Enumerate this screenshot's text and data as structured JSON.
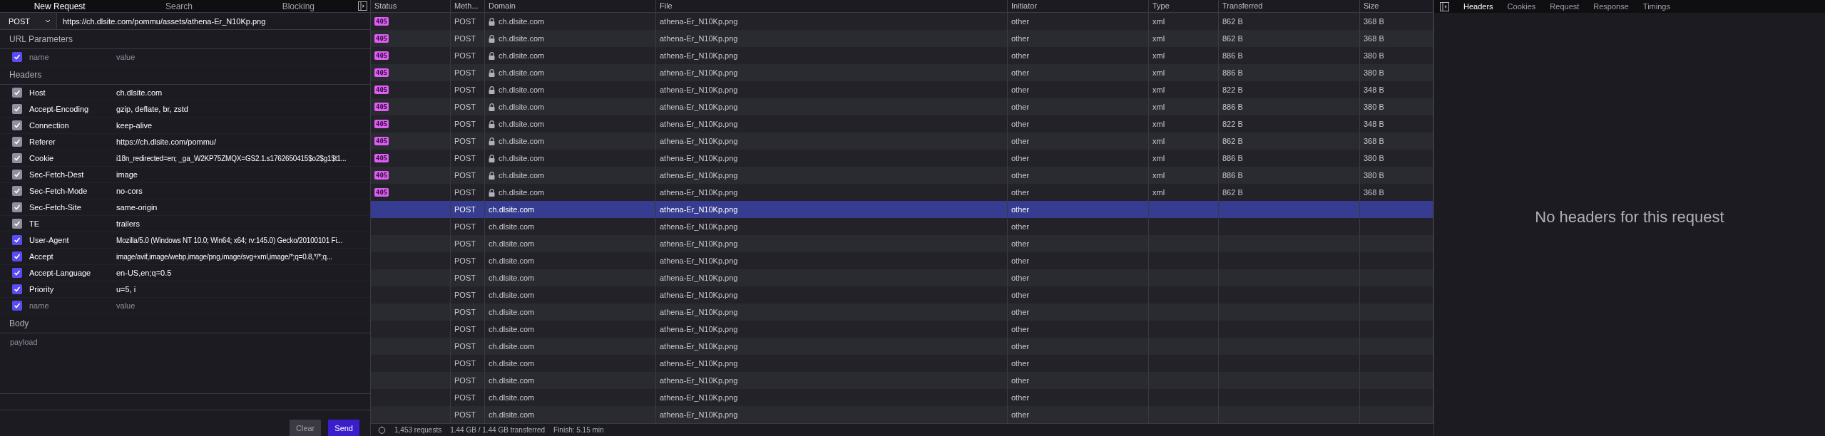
{
  "request_panel": {
    "tabs": [
      {
        "label": "New Request",
        "selected": true
      },
      {
        "label": "Search",
        "selected": false
      },
      {
        "label": "Blocking",
        "selected": false
      }
    ],
    "method": "POST",
    "url": "https://ch.dlsite.com/pommu/assets/athena-Er_N10Kp.png",
    "url_parameters": {
      "title": "URL Parameters",
      "rows": [
        {
          "name_placeholder": "name",
          "value_placeholder": "value",
          "checked": true,
          "disabled": false
        }
      ]
    },
    "headers": {
      "title": "Headers",
      "rows": [
        {
          "name": "Host",
          "value": "ch.dlsite.com",
          "checked": true,
          "disabled": true
        },
        {
          "name": "Accept-Encoding",
          "value": "gzip, deflate, br, zstd",
          "checked": true,
          "disabled": true
        },
        {
          "name": "Connection",
          "value": "keep-alive",
          "checked": true,
          "disabled": true
        },
        {
          "name": "Referer",
          "value": "https://ch.dlsite.com/pommu/",
          "checked": true,
          "disabled": true
        },
        {
          "name": "Cookie",
          "value": "i18n_redirected=en; _ga_W2KP75ZMQX=GS2.1.s1762650415$o2$g1$t1...",
          "checked": true,
          "disabled": true
        },
        {
          "name": "Sec-Fetch-Dest",
          "value": "image",
          "checked": true,
          "disabled": true
        },
        {
          "name": "Sec-Fetch-Mode",
          "value": "no-cors",
          "checked": true,
          "disabled": true
        },
        {
          "name": "Sec-Fetch-Site",
          "value": "same-origin",
          "checked": true,
          "disabled": true
        },
        {
          "name": "TE",
          "value": "trailers",
          "checked": true,
          "disabled": true
        },
        {
          "name": "User-Agent",
          "value": "Mozilla/5.0 (Windows NT 10.0; Win64; x64; rv:145.0) Gecko/20100101 Fi...",
          "checked": true,
          "disabled": false
        },
        {
          "name": "Accept",
          "value": "image/avif,image/webp,image/png,image/svg+xml,image/*;q=0.8,*/*;q...",
          "checked": true,
          "disabled": false
        },
        {
          "name": "Accept-Language",
          "value": "en-US,en;q=0.5",
          "checked": true,
          "disabled": false
        },
        {
          "name": "Priority",
          "value": "u=5, i",
          "checked": true,
          "disabled": false
        },
        {
          "name_placeholder": "name",
          "value_placeholder": "value",
          "checked": true,
          "disabled": false
        }
      ]
    },
    "body": {
      "title": "Body",
      "placeholder": "payload"
    },
    "buttons": [
      {
        "label": "Clear",
        "kind": "secondary"
      },
      {
        "label": "Send",
        "kind": "primary"
      }
    ]
  },
  "table": {
    "columns": [
      "Status",
      "Meth...",
      "Domain",
      "File",
      "Initiator",
      "Type",
      "Transferred",
      "Size"
    ],
    "rows": [
      {
        "status": "405",
        "method": "POST",
        "domain": "ch.dlsite.com",
        "locked": true,
        "file": "athena-Er_N10Kp.png",
        "initiator": "other",
        "type": "xml",
        "transferred": "862 B",
        "size": "368 B",
        "selected": false
      },
      {
        "status": "405",
        "method": "POST",
        "domain": "ch.dlsite.com",
        "locked": true,
        "file": "athena-Er_N10Kp.png",
        "initiator": "other",
        "type": "xml",
        "transferred": "862 B",
        "size": "368 B",
        "selected": false
      },
      {
        "status": "405",
        "method": "POST",
        "domain": "ch.dlsite.com",
        "locked": true,
        "file": "athena-Er_N10Kp.png",
        "initiator": "other",
        "type": "xml",
        "transferred": "886 B",
        "size": "380 B",
        "selected": false
      },
      {
        "status": "405",
        "method": "POST",
        "domain": "ch.dlsite.com",
        "locked": true,
        "file": "athena-Er_N10Kp.png",
        "initiator": "other",
        "type": "xml",
        "transferred": "886 B",
        "size": "380 B",
        "selected": false
      },
      {
        "status": "405",
        "method": "POST",
        "domain": "ch.dlsite.com",
        "locked": true,
        "file": "athena-Er_N10Kp.png",
        "initiator": "other",
        "type": "xml",
        "transferred": "822 B",
        "size": "348 B",
        "selected": false
      },
      {
        "status": "405",
        "method": "POST",
        "domain": "ch.dlsite.com",
        "locked": true,
        "file": "athena-Er_N10Kp.png",
        "initiator": "other",
        "type": "xml",
        "transferred": "886 B",
        "size": "380 B",
        "selected": false
      },
      {
        "status": "405",
        "method": "POST",
        "domain": "ch.dlsite.com",
        "locked": true,
        "file": "athena-Er_N10Kp.png",
        "initiator": "other",
        "type": "xml",
        "transferred": "822 B",
        "size": "348 B",
        "selected": false
      },
      {
        "status": "405",
        "method": "POST",
        "domain": "ch.dlsite.com",
        "locked": true,
        "file": "athena-Er_N10Kp.png",
        "initiator": "other",
        "type": "xml",
        "transferred": "862 B",
        "size": "368 B",
        "selected": false
      },
      {
        "status": "405",
        "method": "POST",
        "domain": "ch.dlsite.com",
        "locked": true,
        "file": "athena-Er_N10Kp.png",
        "initiator": "other",
        "type": "xml",
        "transferred": "886 B",
        "size": "380 B",
        "selected": false
      },
      {
        "status": "405",
        "method": "POST",
        "domain": "ch.dlsite.com",
        "locked": true,
        "file": "athena-Er_N10Kp.png",
        "initiator": "other",
        "type": "xml",
        "transferred": "886 B",
        "size": "380 B",
        "selected": false
      },
      {
        "status": "405",
        "method": "POST",
        "domain": "ch.dlsite.com",
        "locked": true,
        "file": "athena-Er_N10Kp.png",
        "initiator": "other",
        "type": "xml",
        "transferred": "862 B",
        "size": "368 B",
        "selected": false
      },
      {
        "method": "POST",
        "domain": "ch.dlsite.com",
        "locked": false,
        "file": "athena-Er_N10Kp.png",
        "initiator": "other",
        "selected": true
      },
      {
        "method": "POST",
        "domain": "ch.dlsite.com",
        "locked": false,
        "file": "athena-Er_N10Kp.png",
        "initiator": "other",
        "selected": false
      },
      {
        "method": "POST",
        "domain": "ch.dlsite.com",
        "locked": false,
        "file": "athena-Er_N10Kp.png",
        "initiator": "other",
        "selected": false
      },
      {
        "method": "POST",
        "domain": "ch.dlsite.com",
        "locked": false,
        "file": "athena-Er_N10Kp.png",
        "initiator": "other",
        "selected": false
      },
      {
        "method": "POST",
        "domain": "ch.dlsite.com",
        "locked": false,
        "file": "athena-Er_N10Kp.png",
        "initiator": "other",
        "selected": false
      },
      {
        "method": "POST",
        "domain": "ch.dlsite.com",
        "locked": false,
        "file": "athena-Er_N10Kp.png",
        "initiator": "other",
        "selected": false
      },
      {
        "method": "POST",
        "domain": "ch.dlsite.com",
        "locked": false,
        "file": "athena-Er_N10Kp.png",
        "initiator": "other",
        "selected": false
      },
      {
        "method": "POST",
        "domain": "ch.dlsite.com",
        "locked": false,
        "file": "athena-Er_N10Kp.png",
        "initiator": "other",
        "selected": false
      },
      {
        "method": "POST",
        "domain": "ch.dlsite.com",
        "locked": false,
        "file": "athena-Er_N10Kp.png",
        "initiator": "other",
        "selected": false
      },
      {
        "method": "POST",
        "domain": "ch.dlsite.com",
        "locked": false,
        "file": "athena-Er_N10Kp.png",
        "initiator": "other",
        "selected": false
      },
      {
        "method": "POST",
        "domain": "ch.dlsite.com",
        "locked": false,
        "file": "athena-Er_N10Kp.png",
        "initiator": "other",
        "selected": false
      },
      {
        "method": "POST",
        "domain": "ch.dlsite.com",
        "locked": false,
        "file": "athena-Er_N10Kp.png",
        "initiator": "other",
        "selected": false
      },
      {
        "method": "POST",
        "domain": "ch.dlsite.com",
        "locked": false,
        "file": "athena-Er_N10Kp.png",
        "initiator": "other",
        "selected": false
      }
    ]
  },
  "status_bar": [
    "1,453 requests",
    "1.44 GB / 1.44 GB transferred",
    "Finish: 5.15 min"
  ],
  "details_panel": {
    "tabs": [
      {
        "label": "Headers",
        "selected": true
      },
      {
        "label": "Cookies",
        "selected": false
      },
      {
        "label": "Request",
        "selected": false
      },
      {
        "label": "Response",
        "selected": false
      },
      {
        "label": "Timings",
        "selected": false
      }
    ],
    "empty_message": "No headers for this request"
  }
}
